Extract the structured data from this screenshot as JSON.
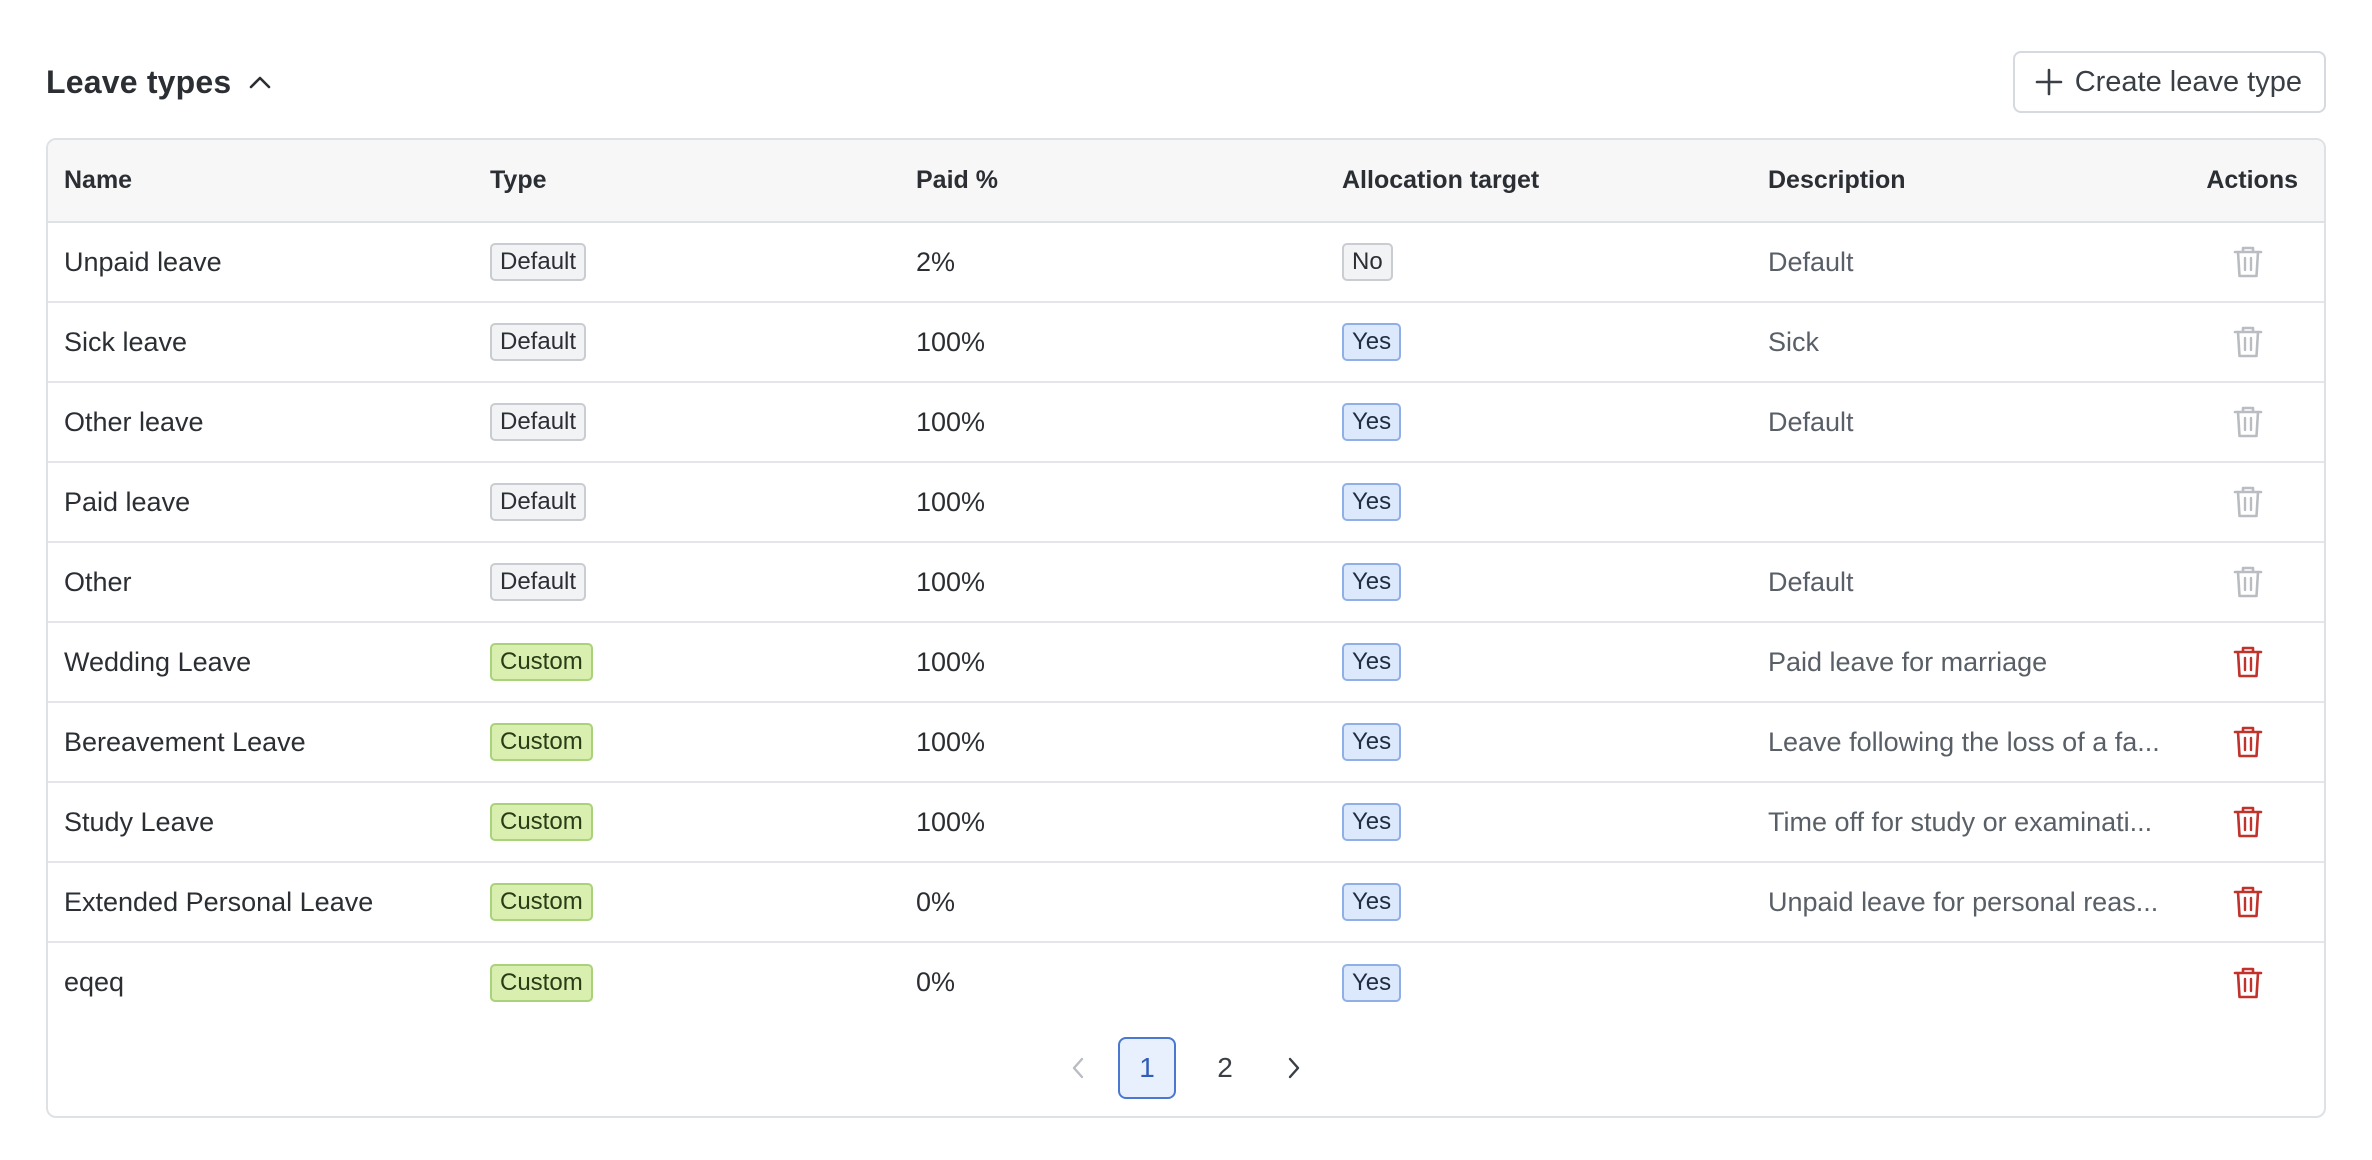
{
  "header": {
    "title": "Leave types",
    "create_button_label": "Create leave type"
  },
  "table": {
    "columns": {
      "name": "Name",
      "type": "Type",
      "paid": "Paid %",
      "allocation": "Allocation target",
      "description": "Description",
      "actions": "Actions"
    },
    "rows": [
      {
        "name": "Unpaid leave",
        "type": "Default",
        "paid": "2%",
        "allocation": "No",
        "description": "Default",
        "deletable": false
      },
      {
        "name": "Sick leave",
        "type": "Default",
        "paid": "100%",
        "allocation": "Yes",
        "description": "Sick",
        "deletable": false
      },
      {
        "name": "Other leave",
        "type": "Default",
        "paid": "100%",
        "allocation": "Yes",
        "description": "Default",
        "deletable": false
      },
      {
        "name": "Paid leave",
        "type": "Default",
        "paid": "100%",
        "allocation": "Yes",
        "description": "",
        "deletable": false
      },
      {
        "name": "Other",
        "type": "Default",
        "paid": "100%",
        "allocation": "Yes",
        "description": "Default",
        "deletable": false
      },
      {
        "name": "Wedding Leave",
        "type": "Custom",
        "paid": "100%",
        "allocation": "Yes",
        "description": "Paid leave for marriage",
        "deletable": true
      },
      {
        "name": "Bereavement Leave",
        "type": "Custom",
        "paid": "100%",
        "allocation": "Yes",
        "description": "Leave following the loss of a fa...",
        "deletable": true
      },
      {
        "name": "Study Leave",
        "type": "Custom",
        "paid": "100%",
        "allocation": "Yes",
        "description": "Time off for study or examinati...",
        "deletable": true
      },
      {
        "name": "Extended Personal Leave",
        "type": "Custom",
        "paid": "0%",
        "allocation": "Yes",
        "description": "Unpaid leave for personal reas...",
        "deletable": true
      },
      {
        "name": "eqeq",
        "type": "Custom",
        "paid": "0%",
        "allocation": "Yes",
        "description": "",
        "deletable": true
      }
    ]
  },
  "pagination": {
    "pages": [
      "1",
      "2"
    ],
    "current": "1"
  },
  "colors": {
    "trash_enabled": "#c0322b",
    "trash_disabled": "#b9bdc2",
    "pagination_active": "#4a78d0"
  },
  "icons": {
    "collapse": "chevron-up-icon",
    "create": "plus-icon",
    "delete": "trash-icon",
    "prev": "chevron-left-icon",
    "next": "chevron-right-icon"
  }
}
